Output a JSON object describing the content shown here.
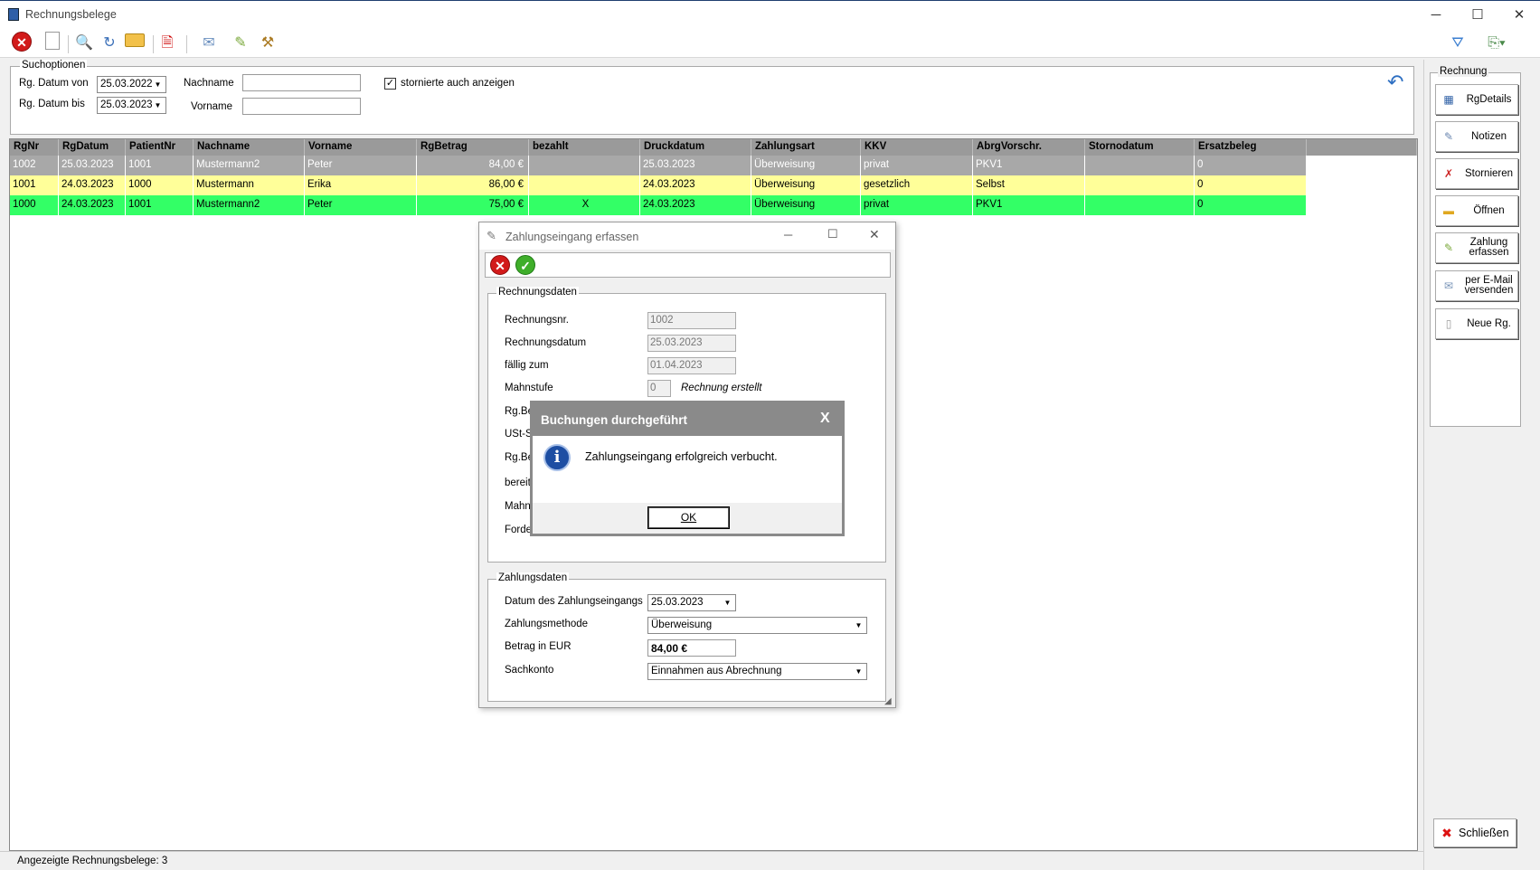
{
  "window": {
    "title": "Rechnungsbelege"
  },
  "toolbar": {
    "items": [
      "close-icon",
      "new-document-icon",
      "preview-icon",
      "refresh-icon",
      "open-folder-icon",
      "delete-icon",
      "email-icon",
      "payment-icon",
      "tools-icon",
      "filter-clear-icon",
      "export-icon"
    ]
  },
  "search": {
    "legend": "Suchoptionen",
    "date_from_label": "Rg. Datum  von",
    "date_from": "25.03.2022",
    "date_to_label": "Rg. Datum  bis",
    "date_to": "25.03.2023",
    "lastname_label": "Nachname",
    "lastname": "",
    "firstname_label": "Vorname",
    "firstname": "",
    "show_cancelled_label": "stornierte auch anzeigen",
    "show_cancelled": true,
    "checkmark": "✓"
  },
  "grid": {
    "columns": [
      "RgNr",
      "RgDatum",
      "PatientNr",
      "Nachname",
      "Vorname",
      "RgBetrag",
      "bezahlt",
      "Druckdatum",
      "Zahlungsart",
      "KKV",
      "AbrgVorschr.",
      "Stornodatum",
      "Ersatzbeleg"
    ],
    "rows": [
      {
        "cells": [
          "1002",
          "25.03.2023",
          "1001",
          "Mustermann2",
          "Peter",
          "84,00 €",
          "",
          "25.03.2023",
          "Überweisung",
          "privat",
          "PKV1",
          "",
          "0"
        ],
        "bg": "#a8a8a8",
        "fg": "#ffffff"
      },
      {
        "cells": [
          "1001",
          "24.03.2023",
          "1000",
          "Mustermann",
          "Erika",
          "86,00 €",
          "",
          "24.03.2023",
          "Überweisung",
          "gesetzlich",
          "Selbst",
          "",
          "0"
        ],
        "bg": "#ffff99",
        "fg": "#000000"
      },
      {
        "cells": [
          "1000",
          "24.03.2023",
          "1001",
          "Mustermann2",
          "Peter",
          "75,00 €",
          "X",
          "24.03.2023",
          "Überweisung",
          "privat",
          "PKV1",
          "",
          "0"
        ],
        "bg": "#33ff66",
        "fg": "#000000"
      }
    ]
  },
  "panel": {
    "legend": "Rechnung",
    "buttons": [
      {
        "name": "rgdetails-button",
        "label": "RgDetails",
        "icon": "table-icon"
      },
      {
        "name": "notizen-button",
        "label": "Notizen",
        "icon": "note-icon"
      },
      {
        "name": "stornieren-button",
        "label": "Stornieren",
        "icon": "cancel-document-icon"
      },
      {
        "name": "oeffnen-button",
        "label": "Öffnen",
        "icon": "folder-icon"
      },
      {
        "name": "zahlung-erfassen-button",
        "label": "Zahlung\nerfassen",
        "icon": "payment-icon"
      },
      {
        "name": "email-versenden-button",
        "label": "per E-Mail\nversenden",
        "icon": "email-icon"
      },
      {
        "name": "neue-rechnung-button",
        "label": "Neue Rg.",
        "icon": "new-document-icon"
      }
    ],
    "close_label": "Schließen",
    "close_glyph": "✖"
  },
  "status": {
    "text": "Angezeigte Rechnungsbelege: 3"
  },
  "dialog": {
    "title": "Zahlungseingang erfassen",
    "invoice_legend": "Rechnungsdaten",
    "fields": {
      "rechnungsnr_label": "Rechnungsnr.",
      "rechnungsnr": "1002",
      "rechnungsdatum_label": "Rechnungsdatum",
      "rechnungsdatum": "25.03.2023",
      "faellig_label": "fällig zum",
      "faellig": "01.04.2023",
      "mahnstufe_label": "Mahnstufe",
      "mahnstufe": "0",
      "mahnstufe_text": "Rechnung erstellt",
      "rgbetrag_label": "Rg.Be",
      "ust_label": "USt-S",
      "rgbe2_label": "Rg.Be",
      "bereits_label": "bereit",
      "mahn_label": "Mahn",
      "forde_label": "Forde"
    },
    "payment_legend": "Zahlungsdaten",
    "payment": {
      "datum_label": "Datum des Zahlungseingangs",
      "datum": "25.03.2023",
      "methode_label": "Zahlungsmethode",
      "methode": "Überweisung",
      "betrag_label": "Betrag in EUR",
      "betrag": "84,00 €",
      "sachkonto_label": "Sachkonto",
      "sachkonto": "Einnahmen aus Abrechnung"
    }
  },
  "messagebox": {
    "title": "Buchungen durchgeführt",
    "close": "X",
    "text": "Zahlungseingang erfolgreich verbucht.",
    "ok": "OK",
    "info_glyph": "i"
  }
}
